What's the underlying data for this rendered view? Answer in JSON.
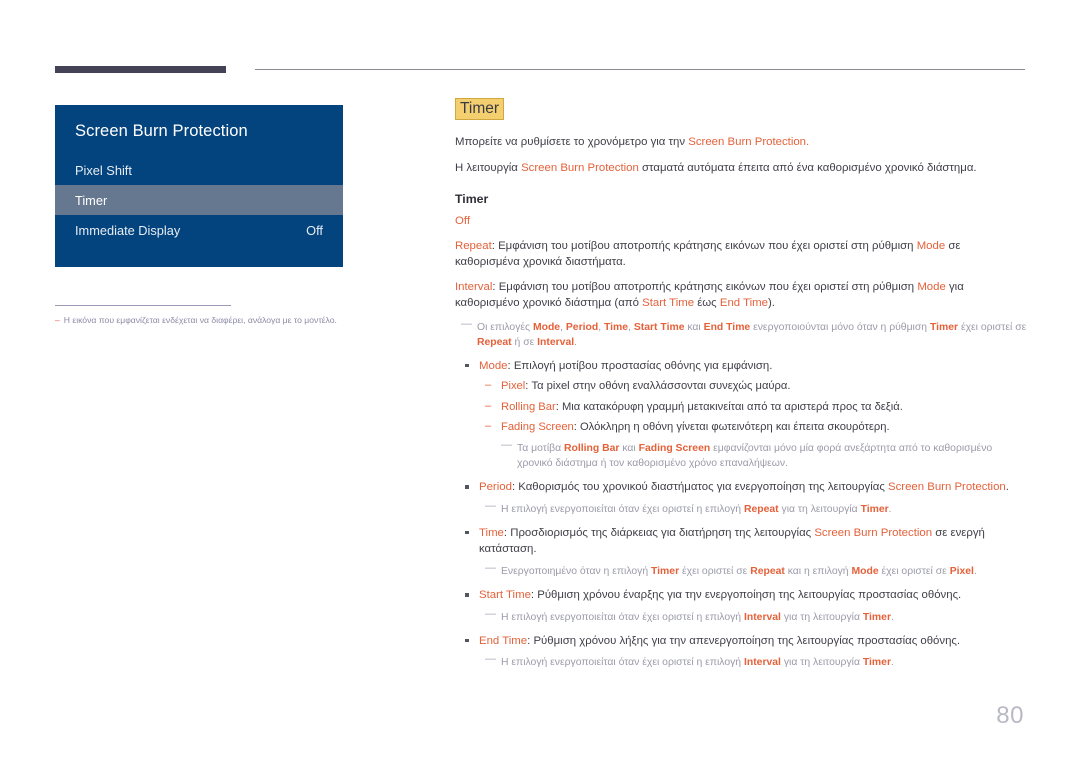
{
  "page": {
    "number": "80"
  },
  "osd": {
    "title": "Screen Burn Protection",
    "rows": [
      {
        "label": "Pixel Shift",
        "value": "",
        "selected": false
      },
      {
        "label": "Timer",
        "value": "",
        "selected": true
      },
      {
        "label": "Immediate Display",
        "value": "Off",
        "selected": false
      }
    ]
  },
  "left_note": {
    "dash": "‒",
    "text": "Η εικόνα που εμφανίζεται ενδέχεται να διαφέρει, ανάλογα με το μοντέλο."
  },
  "content": {
    "heading": "Timer",
    "intro_1": {
      "pre": "Μπορείτε να ρυθμίσετε το χρονόμετρο για την ",
      "kw": "Screen Burn Protection",
      "post": "."
    },
    "intro_2": {
      "pre": "Η λειτουργία ",
      "kw": "Screen Burn Protection",
      "post": " σταματά αυτόματα έπειτα από ένα καθορισμένο χρονικό διάστημα."
    },
    "sub_heading": "Timer",
    "option_off": "Off",
    "option_repeat": {
      "kw": "Repeat",
      "t1": ": Εμφάνιση του μοτίβου αποτροπής κράτησης εικόνων που έχει οριστεί στη ρύθμιση ",
      "kw2": "Mode",
      "t2": " σε καθορισμένα χρονικά διαστήματα."
    },
    "option_interval": {
      "kw": "Interval",
      "t1": ": Εμφάνιση του μοτίβου αποτροπής κράτησης εικόνων που έχει οριστεί στη ρύθμιση ",
      "kw2": "Mode",
      "t2": " για καθορισμένο χρονικό διάστημα (από ",
      "kw3": "Start Time",
      "t3": " έως ",
      "kw4": "End Time",
      "t4": ")."
    },
    "note_options": {
      "t1": "Οι επιλογές ",
      "kw1": "Mode",
      "t2": ", ",
      "kw2": "Period",
      "t3": ", ",
      "kw3": "Time",
      "t4": ", ",
      "kw4": "Start Time",
      "t5": " και ",
      "kw5": "End Time",
      "t6": " ενεργοποιούνται μόνο όταν η ρύθμιση ",
      "kw6": "Timer",
      "t7": " έχει οριστεί σε ",
      "kw7": "Repeat",
      "t8": " ή σε ",
      "kw8": "Interval",
      "t9": "."
    },
    "bullet_mode": {
      "kw": "Mode",
      "text": ": Επιλογή μοτίβου προστασίας οθόνης για εμφάνιση.",
      "sub": [
        {
          "kw": "Pixel",
          "text": ": Τα pixel στην οθόνη εναλλάσσονται συνεχώς μαύρα."
        },
        {
          "kw": "Rolling Bar",
          "text": ": Μια κατακόρυφη γραμμή μετακινείται από τα αριστερά προς τα δεξιά."
        },
        {
          "kw": "Fading Screen",
          "text": ": Ολόκληρη η οθόνη γίνεται φωτεινότερη και έπειτα σκουρότερη."
        }
      ]
    },
    "note_patterns": {
      "t1": "Τα μοτίβα ",
      "kw1": "Rolling Bar",
      "t2": " και ",
      "kw2": "Fading Screen",
      "t3": " εμφανίζονται μόνο μία φορά ανεξάρτητα από το καθορισμένο χρονικό διάστημα ή τον καθορισμένο χρόνο επαναλήψεων."
    },
    "bullet_period": {
      "kw": "Period",
      "t1": ": Καθορισμός του χρονικού διαστήματος για ενεργοποίηση της λειτουργίας ",
      "kw2": "Screen Burn Protection",
      "t2": "."
    },
    "note_period": {
      "t1": "Η επιλογή ενεργοποιείται όταν έχει οριστεί η επιλογή ",
      "kw1": "Repeat",
      "t2": " για τη λειτουργία ",
      "kw2": "Timer",
      "t3": "."
    },
    "bullet_time": {
      "kw": "Time",
      "t1": ": Προσδιορισμός της διάρκειας για διατήρηση της λειτουργίας ",
      "kw2": "Screen Burn Protection",
      "t2": " σε ενεργή κατάσταση."
    },
    "note_time": {
      "t1": "Ενεργοποιημένο όταν η επιλογή ",
      "kw1": "Timer",
      "t2": " έχει οριστεί σε ",
      "kw2": "Repeat",
      "t3": " και η επιλογή ",
      "kw3": "Mode",
      "t4": " έχει οριστεί σε ",
      "kw4": "Pixel",
      "t5": "."
    },
    "bullet_start_time": {
      "kw": "Start Time",
      "text": ": Ρύθμιση χρόνου έναρξης για την ενεργοποίηση της λειτουργίας προστασίας οθόνης."
    },
    "note_start_time": {
      "t1": "Η επιλογή ενεργοποιείται όταν έχει οριστεί η επιλογή ",
      "kw1": "Interval",
      "t2": " για τη λειτουργία ",
      "kw2": "Timer",
      "t3": "."
    },
    "bullet_end_time": {
      "kw": "End Time",
      "text": ": Ρύθμιση χρόνου λήξης για την απενεργοποίηση της λειτουργίας προστασίας οθόνης."
    },
    "note_end_time": {
      "t1": "Η επιλογή ενεργοποιείται όταν έχει οριστεί η επιλογή ",
      "kw1": "Interval",
      "t2": " για τη λειτουργία ",
      "kw2": "Timer",
      "t3": "."
    }
  }
}
